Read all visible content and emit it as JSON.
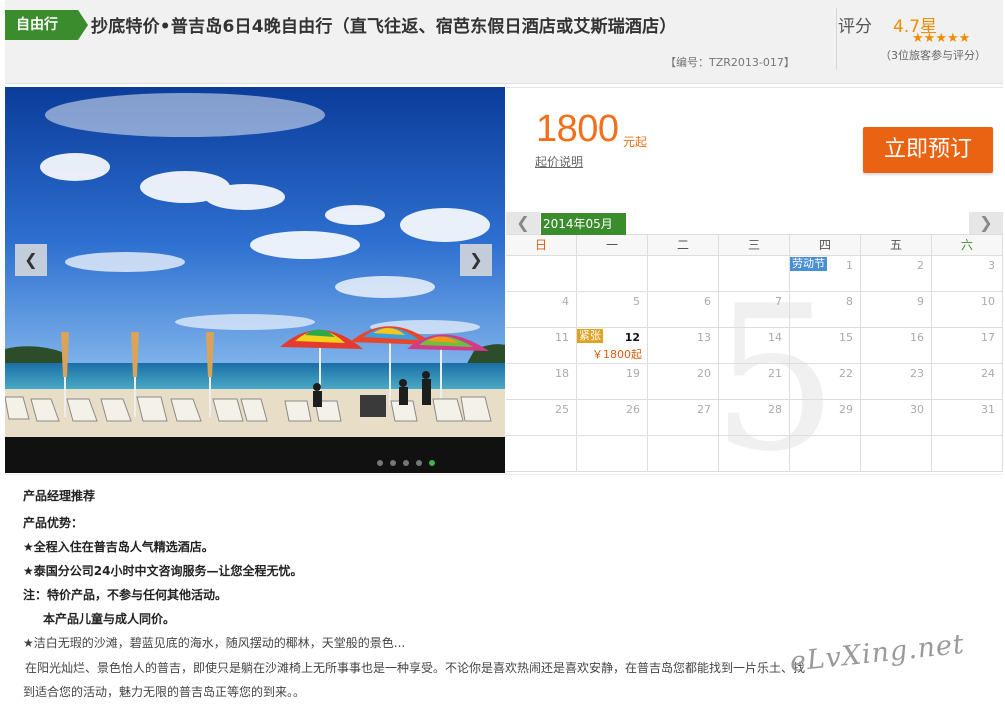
{
  "header": {
    "tag": "自由行",
    "title": "抄底特价•普吉岛6日4晚自由行（直飞往返、宿芭东假日酒店或艾斯瑞酒店）",
    "code": "【编号：TZR2013-017】",
    "rating_label": "评分",
    "rating_value": "4.7星",
    "rating_stars": 5,
    "rating_count_text": "（3位旅客参与评分）"
  },
  "gallery": {
    "prev_icon": "chevron-left-icon",
    "next_icon": "chevron-right-icon",
    "slide_count": 5,
    "active_slide": 5
  },
  "booking": {
    "price": "1800",
    "price_unit": "元起",
    "price_note": "起价说明",
    "book_label": "立即预订"
  },
  "calendar": {
    "month_label": "2014年05月",
    "watermark_month": "5",
    "weekdays": [
      "日",
      "一",
      "二",
      "三",
      "四",
      "五",
      "六"
    ],
    "weeks": [
      [
        {
          "d": ""
        },
        {
          "d": ""
        },
        {
          "d": ""
        },
        {
          "d": ""
        },
        {
          "d": "1",
          "badge": "劳动节"
        },
        {
          "d": "2"
        },
        {
          "d": "3"
        }
      ],
      [
        {
          "d": "4"
        },
        {
          "d": "5"
        },
        {
          "d": "6"
        },
        {
          "d": "7"
        },
        {
          "d": "8"
        },
        {
          "d": "9"
        },
        {
          "d": "10"
        }
      ],
      [
        {
          "d": "11"
        },
        {
          "d": "12",
          "tag": "紧张",
          "price": "￥1800起",
          "active": true
        },
        {
          "d": "13"
        },
        {
          "d": "14"
        },
        {
          "d": "15"
        },
        {
          "d": "16"
        },
        {
          "d": "17"
        }
      ],
      [
        {
          "d": "18"
        },
        {
          "d": "19"
        },
        {
          "d": "20"
        },
        {
          "d": "21"
        },
        {
          "d": "22"
        },
        {
          "d": "23"
        },
        {
          "d": "24"
        }
      ],
      [
        {
          "d": "25"
        },
        {
          "d": "26"
        },
        {
          "d": "27"
        },
        {
          "d": "28"
        },
        {
          "d": "29"
        },
        {
          "d": "30"
        },
        {
          "d": "31"
        }
      ],
      [
        {
          "d": ""
        },
        {
          "d": ""
        },
        {
          "d": ""
        },
        {
          "d": ""
        },
        {
          "d": ""
        },
        {
          "d": ""
        },
        {
          "d": ""
        }
      ]
    ]
  },
  "description": {
    "heading": "产品经理推荐",
    "advantage_label": "产品优势：",
    "line1": "★全程入住在普吉岛人气精选酒店。",
    "line2": "★泰国分公司24小时中文咨询服务—让您全程无忧。",
    "line3": "注：特价产品，不参与任何其他活动。",
    "line4": "本产品儿童与成人同价。",
    "line5": "★洁白无瑕的沙滩，碧蓝见底的海水，随风摆动的椰林，天堂般的景色...",
    "line6": "在阳光灿烂、景色怡人的普吉，即使只是躺在沙滩椅上无所事事也是一种享受。不论你是喜欢热闹还是喜欢安静，在普吉岛您都能找到一片乐土、找",
    "line7": "到适合您的活动，魅力无限的普吉岛正等您的到来。。"
  },
  "watermark": "eLvXing.net"
}
